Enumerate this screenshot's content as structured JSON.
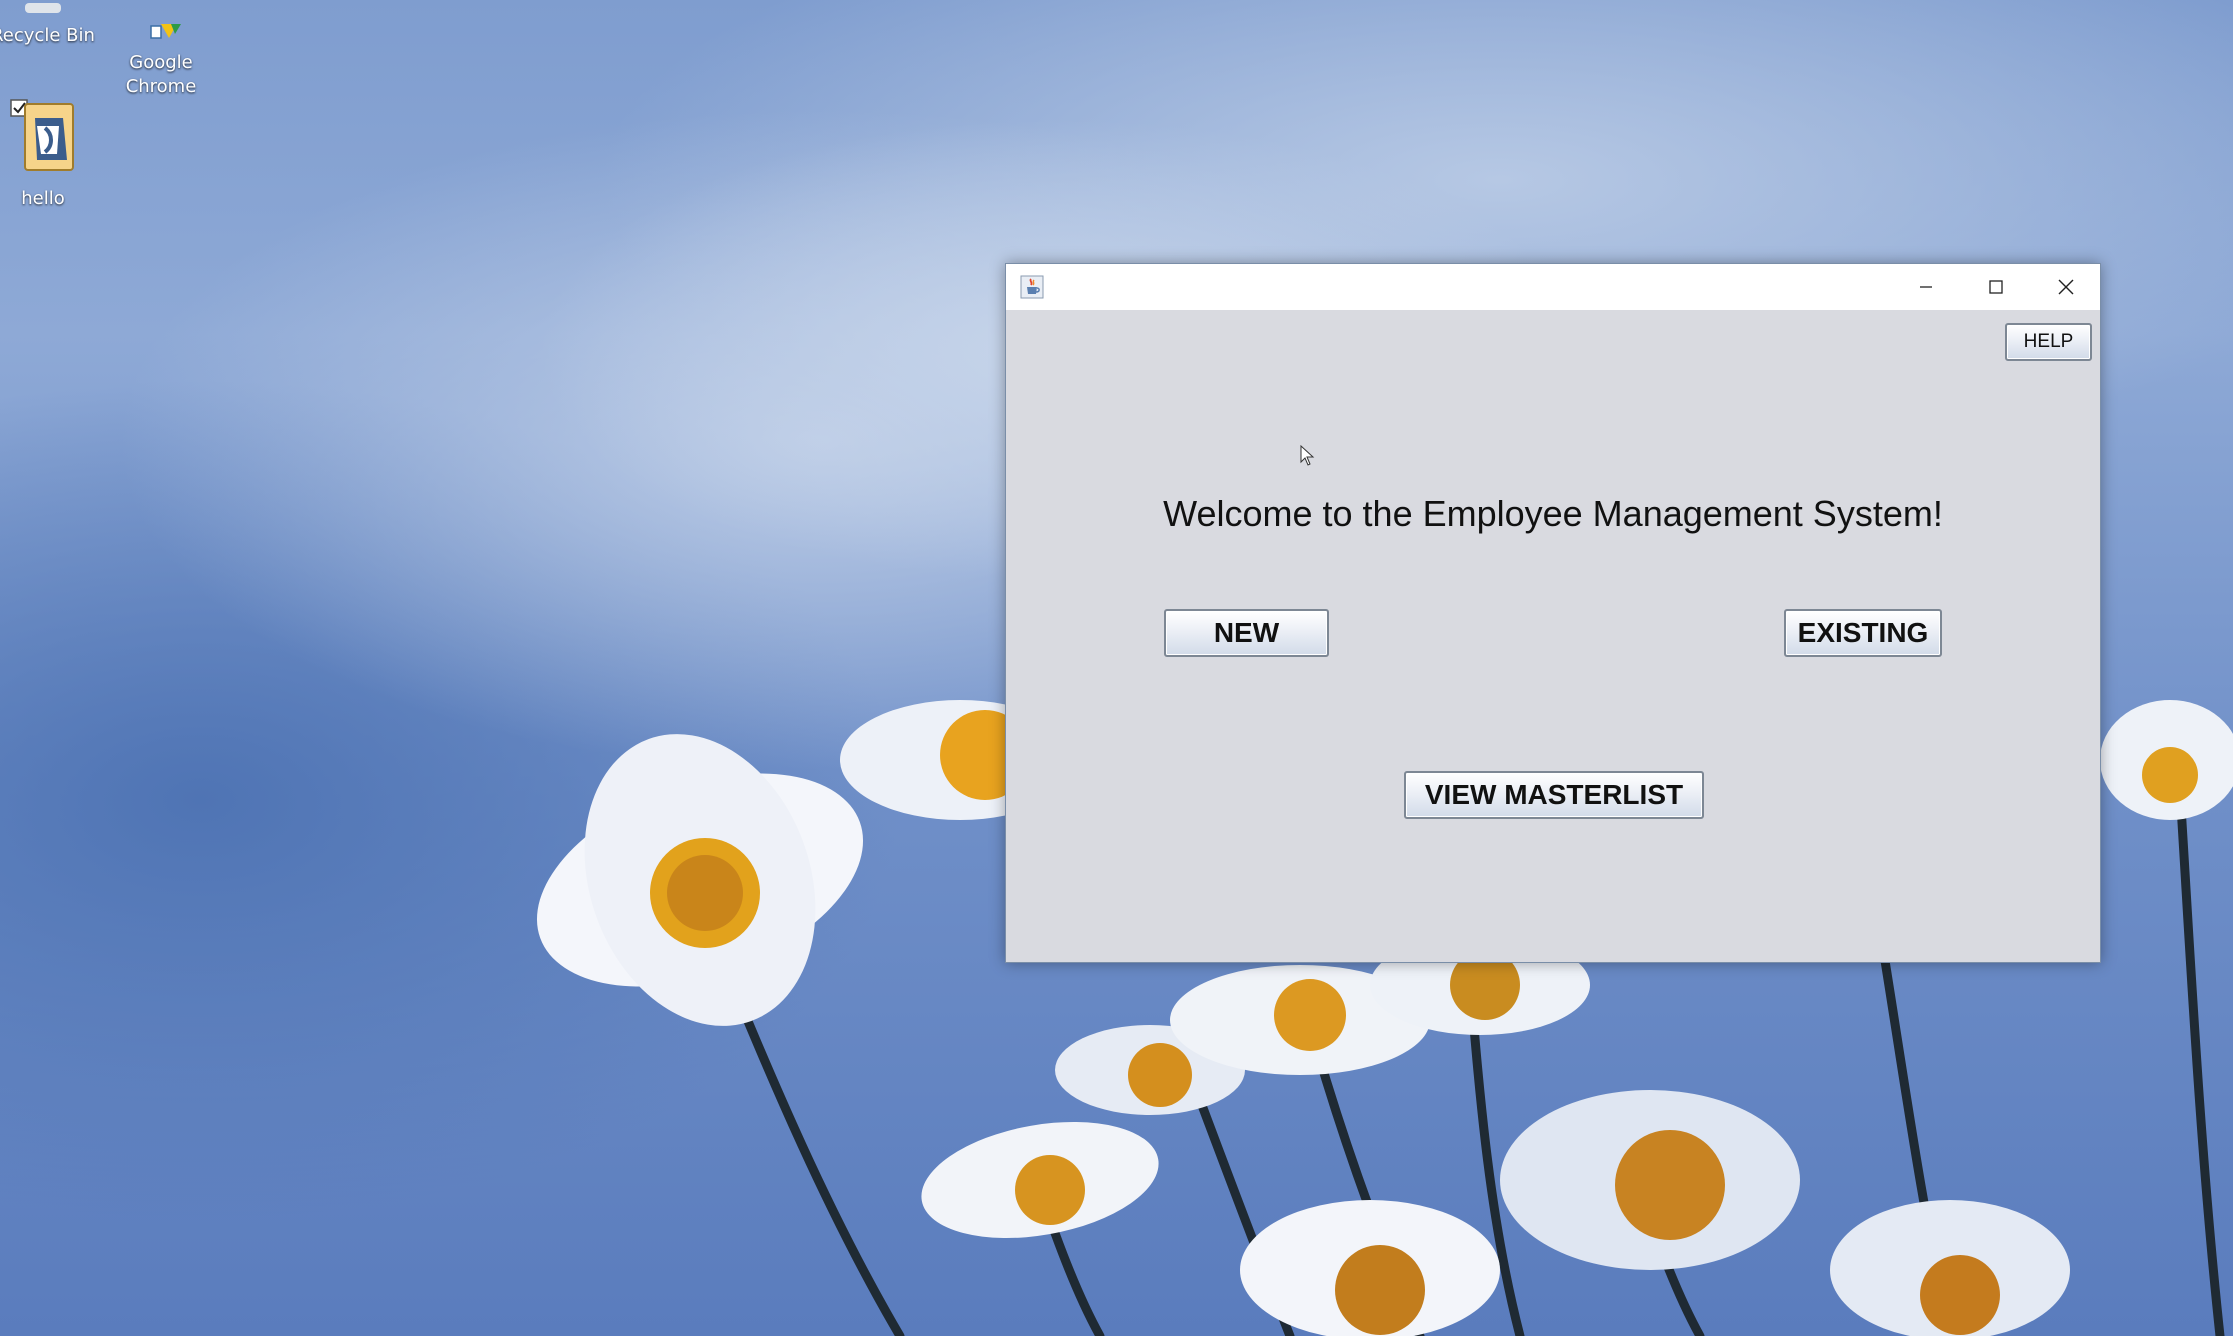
{
  "desktop": {
    "icons": [
      {
        "label": "Recycle Bin",
        "icon": "recycle-bin-icon"
      },
      {
        "label": "Google\nChrome",
        "icon": "chrome-icon"
      },
      {
        "label": "hello",
        "icon": "document-shortcut-icon"
      }
    ]
  },
  "window": {
    "title": "",
    "app_icon": "java-cup-icon",
    "controls": {
      "minimize": "minimize-icon",
      "maximize": "maximize-icon",
      "close": "close-icon"
    },
    "help_label": "HELP",
    "welcome_text": "Welcome to the Employee Management System!",
    "new_label": "NEW",
    "existing_label": "EXISTING",
    "view_masterlist_label": "VIEW MASTERLIST"
  },
  "colors": {
    "window_background": "#d9dae0",
    "title_bar": "#ffffff",
    "desktop_blue": "#7f9dcf"
  }
}
